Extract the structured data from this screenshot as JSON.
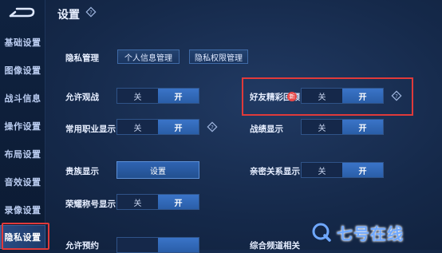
{
  "header": {
    "title": "设置",
    "help_icon": "diamond-question-icon"
  },
  "sidebar": {
    "back_icon": "back-arrow-icon",
    "items": [
      {
        "label": "基础设置"
      },
      {
        "label": "图像设置"
      },
      {
        "label": "战斗信息"
      },
      {
        "label": "操作设置"
      },
      {
        "label": "布局设置"
      },
      {
        "label": "音效设置"
      },
      {
        "label": "录像设置"
      },
      {
        "label": "隐私设置",
        "active": true
      }
    ]
  },
  "privacy": {
    "manage_label": "隐私管理",
    "personal_info_button": "个人信息管理",
    "permission_button": "隐私权限管理"
  },
  "settings": {
    "allow_watch": {
      "label": "允许观战",
      "off": "关",
      "on": "开"
    },
    "friend_highlight": {
      "label": "好友精彩回顾",
      "badge": "新",
      "off": "关",
      "on": "开"
    },
    "common_job": {
      "label": "常用职业显示",
      "off": "关",
      "on": "开"
    },
    "battle_display": {
      "label": "战绩显示",
      "off": "关",
      "on": "开"
    },
    "noble_display": {
      "label": "贵族显示",
      "button": "设置"
    },
    "intimacy_display": {
      "label": "亲密关系显示",
      "off": "关",
      "on": "开"
    },
    "honor_title": {
      "label": "荣耀称号显示",
      "off": "关",
      "on": "开"
    },
    "partial_left_label": "允许预约",
    "partial_right_label": "综合频道相关"
  },
  "watermark": {
    "text": "七号在线"
  },
  "colors": {
    "accent": "#3a74c8",
    "highlight": "#e03a3a",
    "watermark": "#6fa8ff"
  }
}
